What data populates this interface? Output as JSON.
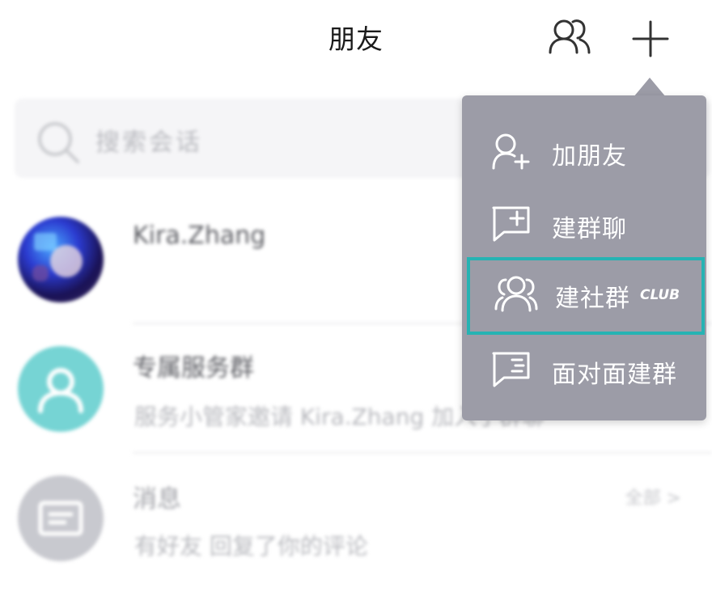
{
  "header": {
    "title": "朋友",
    "icons": [
      "contacts-icon",
      "plus-icon"
    ]
  },
  "search": {
    "placeholder": "搜索会话"
  },
  "conversations": [
    {
      "name": "Kira.Zhang",
      "subtitle": "",
      "avatar": "photo"
    },
    {
      "name": "专属服务群",
      "subtitle": "服务小管家邀请 Kira.Zhang 加入了群聊",
      "avatar_color": "#76d4d4"
    },
    {
      "name": "消息",
      "subtitle": "有好友 回复了你的评论",
      "meta": "全部 >",
      "avatar_color": "#c8c9cf"
    }
  ],
  "menu": {
    "background": "#9c9ca7",
    "highlight_color": "#26b3b3",
    "items": [
      {
        "label": "加朋友",
        "icon": "add-friend-icon"
      },
      {
        "label": "建群聊",
        "icon": "new-group-chat-icon"
      },
      {
        "label": "建社群",
        "badge": "CLUB",
        "icon": "community-icon",
        "selected": true
      },
      {
        "label": "面对面建群",
        "icon": "face-to-face-icon"
      }
    ]
  }
}
